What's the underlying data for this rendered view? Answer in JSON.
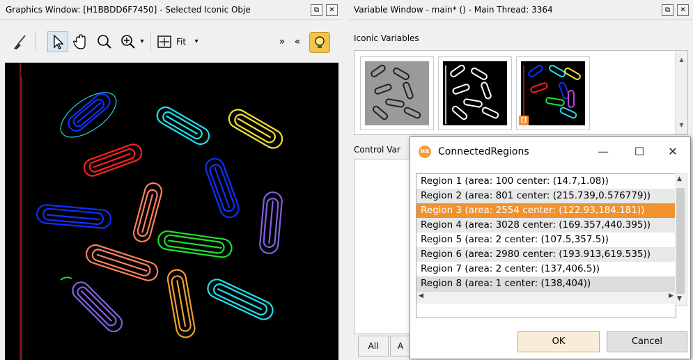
{
  "graphics_window": {
    "title": "Graphics Window: [H1BBDD6F7450] - Selected Iconic Obje",
    "tools": {
      "fit_label": "Fit",
      "nav_more": "»",
      "nav_less": "«"
    },
    "window_buttons": [
      "⧉",
      "✕"
    ]
  },
  "variable_window": {
    "title": "Variable Window - main* () - Main Thread: 3364",
    "iconic_label": "Iconic Variables",
    "control_label": "Control Var",
    "thumb_badge": "[]",
    "tabs": [
      "All",
      "A"
    ],
    "window_buttons": [
      "⧉",
      "✕"
    ]
  },
  "dialog": {
    "title": "ConnectedRegions",
    "icon_text": "HA",
    "controls": [
      "—",
      "☐",
      "✕"
    ],
    "regions": [
      "Region 1  (area: 100 center: (14.7,1.08))",
      "Region 2  (area: 801 center: (215.739,0.576779))",
      "Region 3  (area: 2554 center: (122.93,184.181))",
      "Region 4  (area: 3028 center: (169.357,440.395))",
      "Region 5  (area: 2 center: (107.5,357.5))",
      "Region 6  (area: 2980 center: (193.913,619.535))",
      "Region 7  (area: 2 center: (137,406.5))",
      "Region 8  (area: 1 center: (138,404))"
    ],
    "selected_index": 2,
    "ok_label": "OK",
    "cancel_label": "Cancel"
  },
  "colors": {
    "selection": "#f0922e",
    "canvas_bg": "#000000"
  }
}
